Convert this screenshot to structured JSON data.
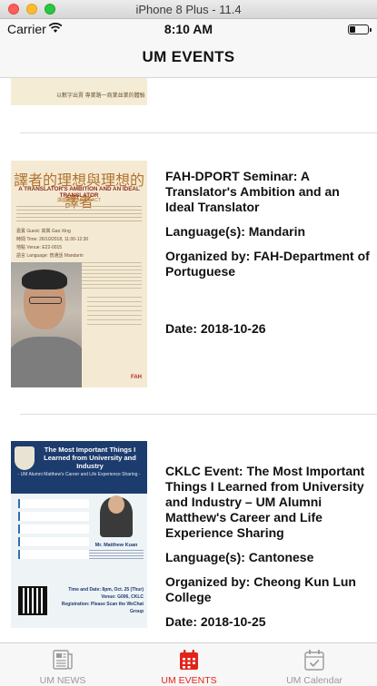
{
  "window": {
    "title": "iPhone 8 Plus - 11.4"
  },
  "status_bar": {
    "carrier": "Carrier",
    "time": "8:10 AM"
  },
  "nav": {
    "title": "UM EVENTS"
  },
  "events": [
    {
      "poster_text": "以數字出賣 專業路一商業並業的體驗"
    },
    {
      "title": "FAH-DPORT Seminar: A Translator's Ambition and an Ideal Translator",
      "language": "Language(s): Mandarin",
      "organizer": "Organized by: FAH-Department of Portuguese",
      "date": "Date: 2018-10-26",
      "poster": {
        "cn_title": "譯者的理想與理想的譯者",
        "en_title": "A TRANSLATOR'S AMBITION AND AN IDEAL TRANSLATOR",
        "abstract": "講座摘要 ABSTRACT",
        "guest": "嘉賓 Guest: 高興 Gao Xing",
        "time": "時間 Time: 26/10/2018, 11:00-12:30",
        "venue": "地點 Venue: E22-0015",
        "language": "語言 Language: 普通話 Mandarin",
        "logo": "FAH"
      }
    },
    {
      "title": "CKLC Event: The Most Important Things I Learned from University and Industry – UM Alumni Matthew's Career and Life Experience Sharing",
      "language": "Language(s): Cantonese",
      "organizer": "Organized by: Cheong Kun Lun College",
      "date": "Date: 2018-10-25",
      "poster": {
        "title": "The Most Important Things I Learned from University and Industry",
        "subtitle": "- UM Alumni Matthew's Career and Life Experience Sharing -",
        "speaker": "Mr. Matthew Kuan",
        "time": "Time and Date: 8pm, Oct. 25 (Thur)",
        "venue": "Venue: G006, CKLC",
        "registration": "Registration: Please Scan the WeChat Group"
      }
    }
  ],
  "tabs": [
    {
      "label": "UM NEWS",
      "icon": "news-icon",
      "active": false
    },
    {
      "label": "UM EVENTS",
      "icon": "calendar-grid-icon",
      "active": true
    },
    {
      "label": "UM Calendar",
      "icon": "calendar-check-icon",
      "active": false
    }
  ],
  "colors": {
    "accent": "#e2231a",
    "inactive": "#9a9a9a"
  }
}
